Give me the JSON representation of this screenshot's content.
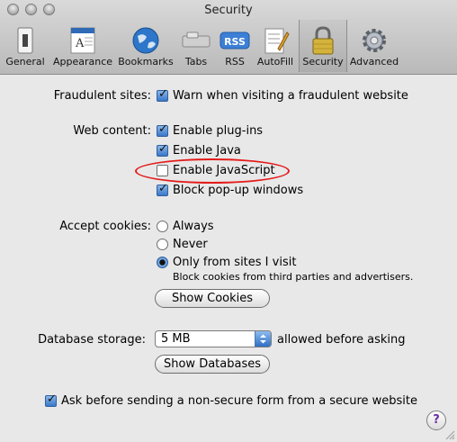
{
  "window": {
    "title": "Security"
  },
  "toolbar": {
    "items": [
      {
        "label": "General",
        "icon": "switch-icon"
      },
      {
        "label": "Appearance",
        "icon": "appearance-icon"
      },
      {
        "label": "Bookmarks",
        "icon": "globe-icon"
      },
      {
        "label": "Tabs",
        "icon": "tabs-icon"
      },
      {
        "label": "RSS",
        "icon": "rss-icon"
      },
      {
        "label": "AutoFill",
        "icon": "autofill-icon"
      },
      {
        "label": "Security",
        "icon": "lock-icon",
        "selected": true
      },
      {
        "label": "Advanced",
        "icon": "gear-icon"
      }
    ]
  },
  "fraud": {
    "label": "Fraudulent sites:",
    "warn_label": "Warn when visiting a fraudulent website",
    "warn_checked": true
  },
  "web_content": {
    "label": "Web content:",
    "options": [
      {
        "label": "Enable plug-ins",
        "checked": true
      },
      {
        "label": "Enable Java",
        "checked": true
      },
      {
        "label": "Enable JavaScript",
        "checked": false
      },
      {
        "label": "Block pop-up windows",
        "checked": true
      }
    ]
  },
  "cookies": {
    "label": "Accept cookies:",
    "options": [
      {
        "label": "Always",
        "selected": false
      },
      {
        "label": "Never",
        "selected": false
      },
      {
        "label": "Only from sites I visit",
        "selected": true
      }
    ],
    "note": "Block cookies from third parties and advertisers.",
    "show_button": "Show Cookies"
  },
  "database": {
    "label": "Database storage:",
    "value": "5 MB",
    "suffix": "allowed before asking",
    "show_button": "Show Databases"
  },
  "nonsecure": {
    "label": "Ask before sending a non-secure form from a secure website",
    "checked": true
  },
  "help": {
    "label": "?"
  },
  "colors": {
    "highlight": "#e41b1b",
    "accent": "#3a78c9"
  }
}
